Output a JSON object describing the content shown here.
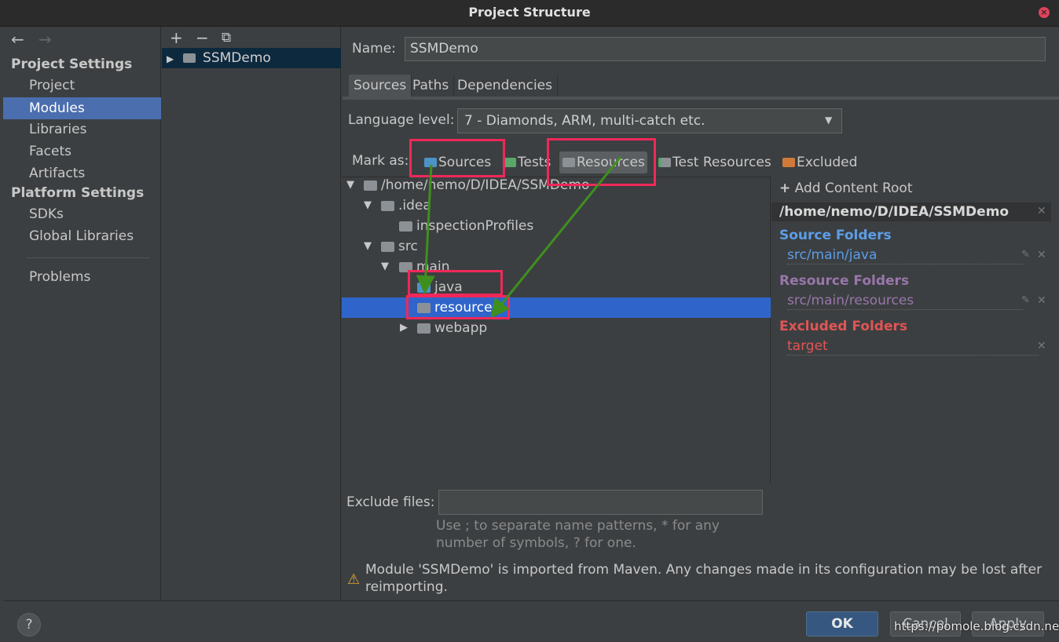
{
  "window": {
    "title": "Project Structure"
  },
  "nav": {
    "back_glyph": "←",
    "forward_glyph": "→",
    "project_settings": "Project Settings",
    "project": "Project",
    "modules": "Modules",
    "libraries": "Libraries",
    "facets": "Facets",
    "artifacts": "Artifacts",
    "platform_settings": "Platform Settings",
    "sdks": "SDKs",
    "global_libraries": "Global Libraries",
    "problems": "Problems"
  },
  "modules_toolbar": {
    "add": "+",
    "remove": "−",
    "copy": "⧉"
  },
  "module_list": {
    "item": "SSMDemo"
  },
  "name_field": {
    "label": "Name:",
    "value": "SSMDemo"
  },
  "tabs": {
    "sources": "Sources",
    "paths": "Paths",
    "dependencies": "Dependencies"
  },
  "language": {
    "label": "Language level:",
    "value": "7 - Diamonds, ARM, multi-catch etc."
  },
  "mark_as": {
    "label": "Mark as:",
    "sources": "Sources",
    "tests": "Tests",
    "resources": "Resources",
    "test_resources": "Test Resources",
    "excluded": "Excluded"
  },
  "tree": {
    "root": "/home/nemo/D/IDEA/SSMDemo",
    "idea": ".idea",
    "inspection": "inspectionProfiles",
    "src": "src",
    "main": "main",
    "java": "java",
    "resources": "resources",
    "webapp": "webapp"
  },
  "roots": {
    "add_content_root": "Add Content Root",
    "content_root": "/home/nemo/D/IDEA/SSMDemo",
    "source_header": "Source Folders",
    "source_path": "src/main/java",
    "resource_header": "Resource Folders",
    "resource_path": "src/main/resources",
    "excluded_header": "Excluded Folders",
    "excluded_path": "target"
  },
  "exclude": {
    "label": "Exclude files:",
    "hint_line1": "Use ; to separate name patterns, * for any",
    "hint_line2": "number of symbols, ? for one."
  },
  "warning": {
    "line1": "Module 'SSMDemo' is imported from Maven. Any changes made in its configuration may be lost after",
    "line2": "reimporting."
  },
  "buttons": {
    "help": "?",
    "ok": "OK",
    "cancel": "Cancel",
    "apply": "Apply"
  },
  "watermark": "https://pomole.blog.csdn.net",
  "colors": {
    "selection": "#2f65ca",
    "nav_selection": "#4b6eaf",
    "source": "#5c9ee8",
    "resource": "#9876aa",
    "excluded": "#e05555",
    "annotation_box": "#f0285a",
    "annotation_arrow": "#3f8f1f"
  }
}
